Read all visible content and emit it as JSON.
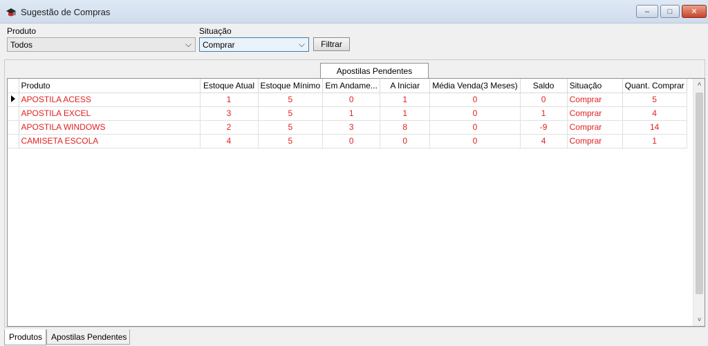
{
  "window": {
    "title": "Sugestão de Compras",
    "icon": "hat-icon",
    "controls": {
      "minimize": "–",
      "maximize": "□",
      "close": "✕"
    }
  },
  "filters": {
    "produto_label": "Produto",
    "produto_value": "Todos",
    "situacao_label": "Situação",
    "situacao_value": "Comprar",
    "filter_button": "Filtrar",
    "dropdown_arrow": "⌵"
  },
  "top_tab": {
    "label": "Apostilas Pendentes"
  },
  "grid": {
    "columns": [
      "Produto",
      "Estoque Atual",
      "Estoque Mínimo",
      "Em Andame...",
      "A Iniciar",
      "Média Venda(3 Meses)",
      "Saldo",
      "Situação",
      "Quant. Comprar"
    ],
    "rows": [
      [
        "APOSTILA ACESS",
        "1",
        "5",
        "0",
        "1",
        "0",
        "0",
        "Comprar",
        "5"
      ],
      [
        "APOSTILA EXCEL",
        "3",
        "5",
        "1",
        "1",
        "0",
        "1",
        "Comprar",
        "4"
      ],
      [
        "APOSTILA WINDOWS",
        "2",
        "5",
        "3",
        "8",
        "0",
        "-9",
        "Comprar",
        "14"
      ],
      [
        "CAMISETA ESCOLA",
        "4",
        "5",
        "0",
        "0",
        "0",
        "4",
        "Comprar",
        "1"
      ]
    ],
    "current_row": 0,
    "row_text_color": "#e02020"
  },
  "scroll": {
    "up": "˄",
    "down": "˅"
  },
  "bottom_tabs": [
    {
      "label": "Produtos",
      "active": true
    },
    {
      "label": "Apostilas Pendentes",
      "active": false
    }
  ]
}
